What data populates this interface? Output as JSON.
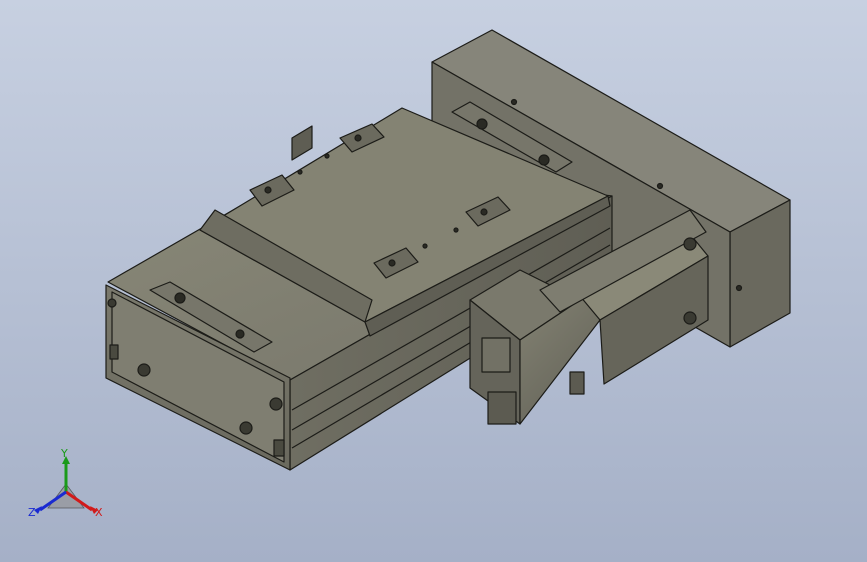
{
  "viewport": {
    "background_top": "#c7d0e1",
    "background_bottom": "#a5b0c7"
  },
  "model": {
    "body_color": "#7c7b6b",
    "edge_color": "#1c1c18"
  },
  "triad": {
    "x_label": "X",
    "y_label": "Y",
    "z_label": "Z",
    "x_color": "#d11a1a",
    "y_color": "#1a9a1a",
    "z_color": "#1a2ad1"
  }
}
